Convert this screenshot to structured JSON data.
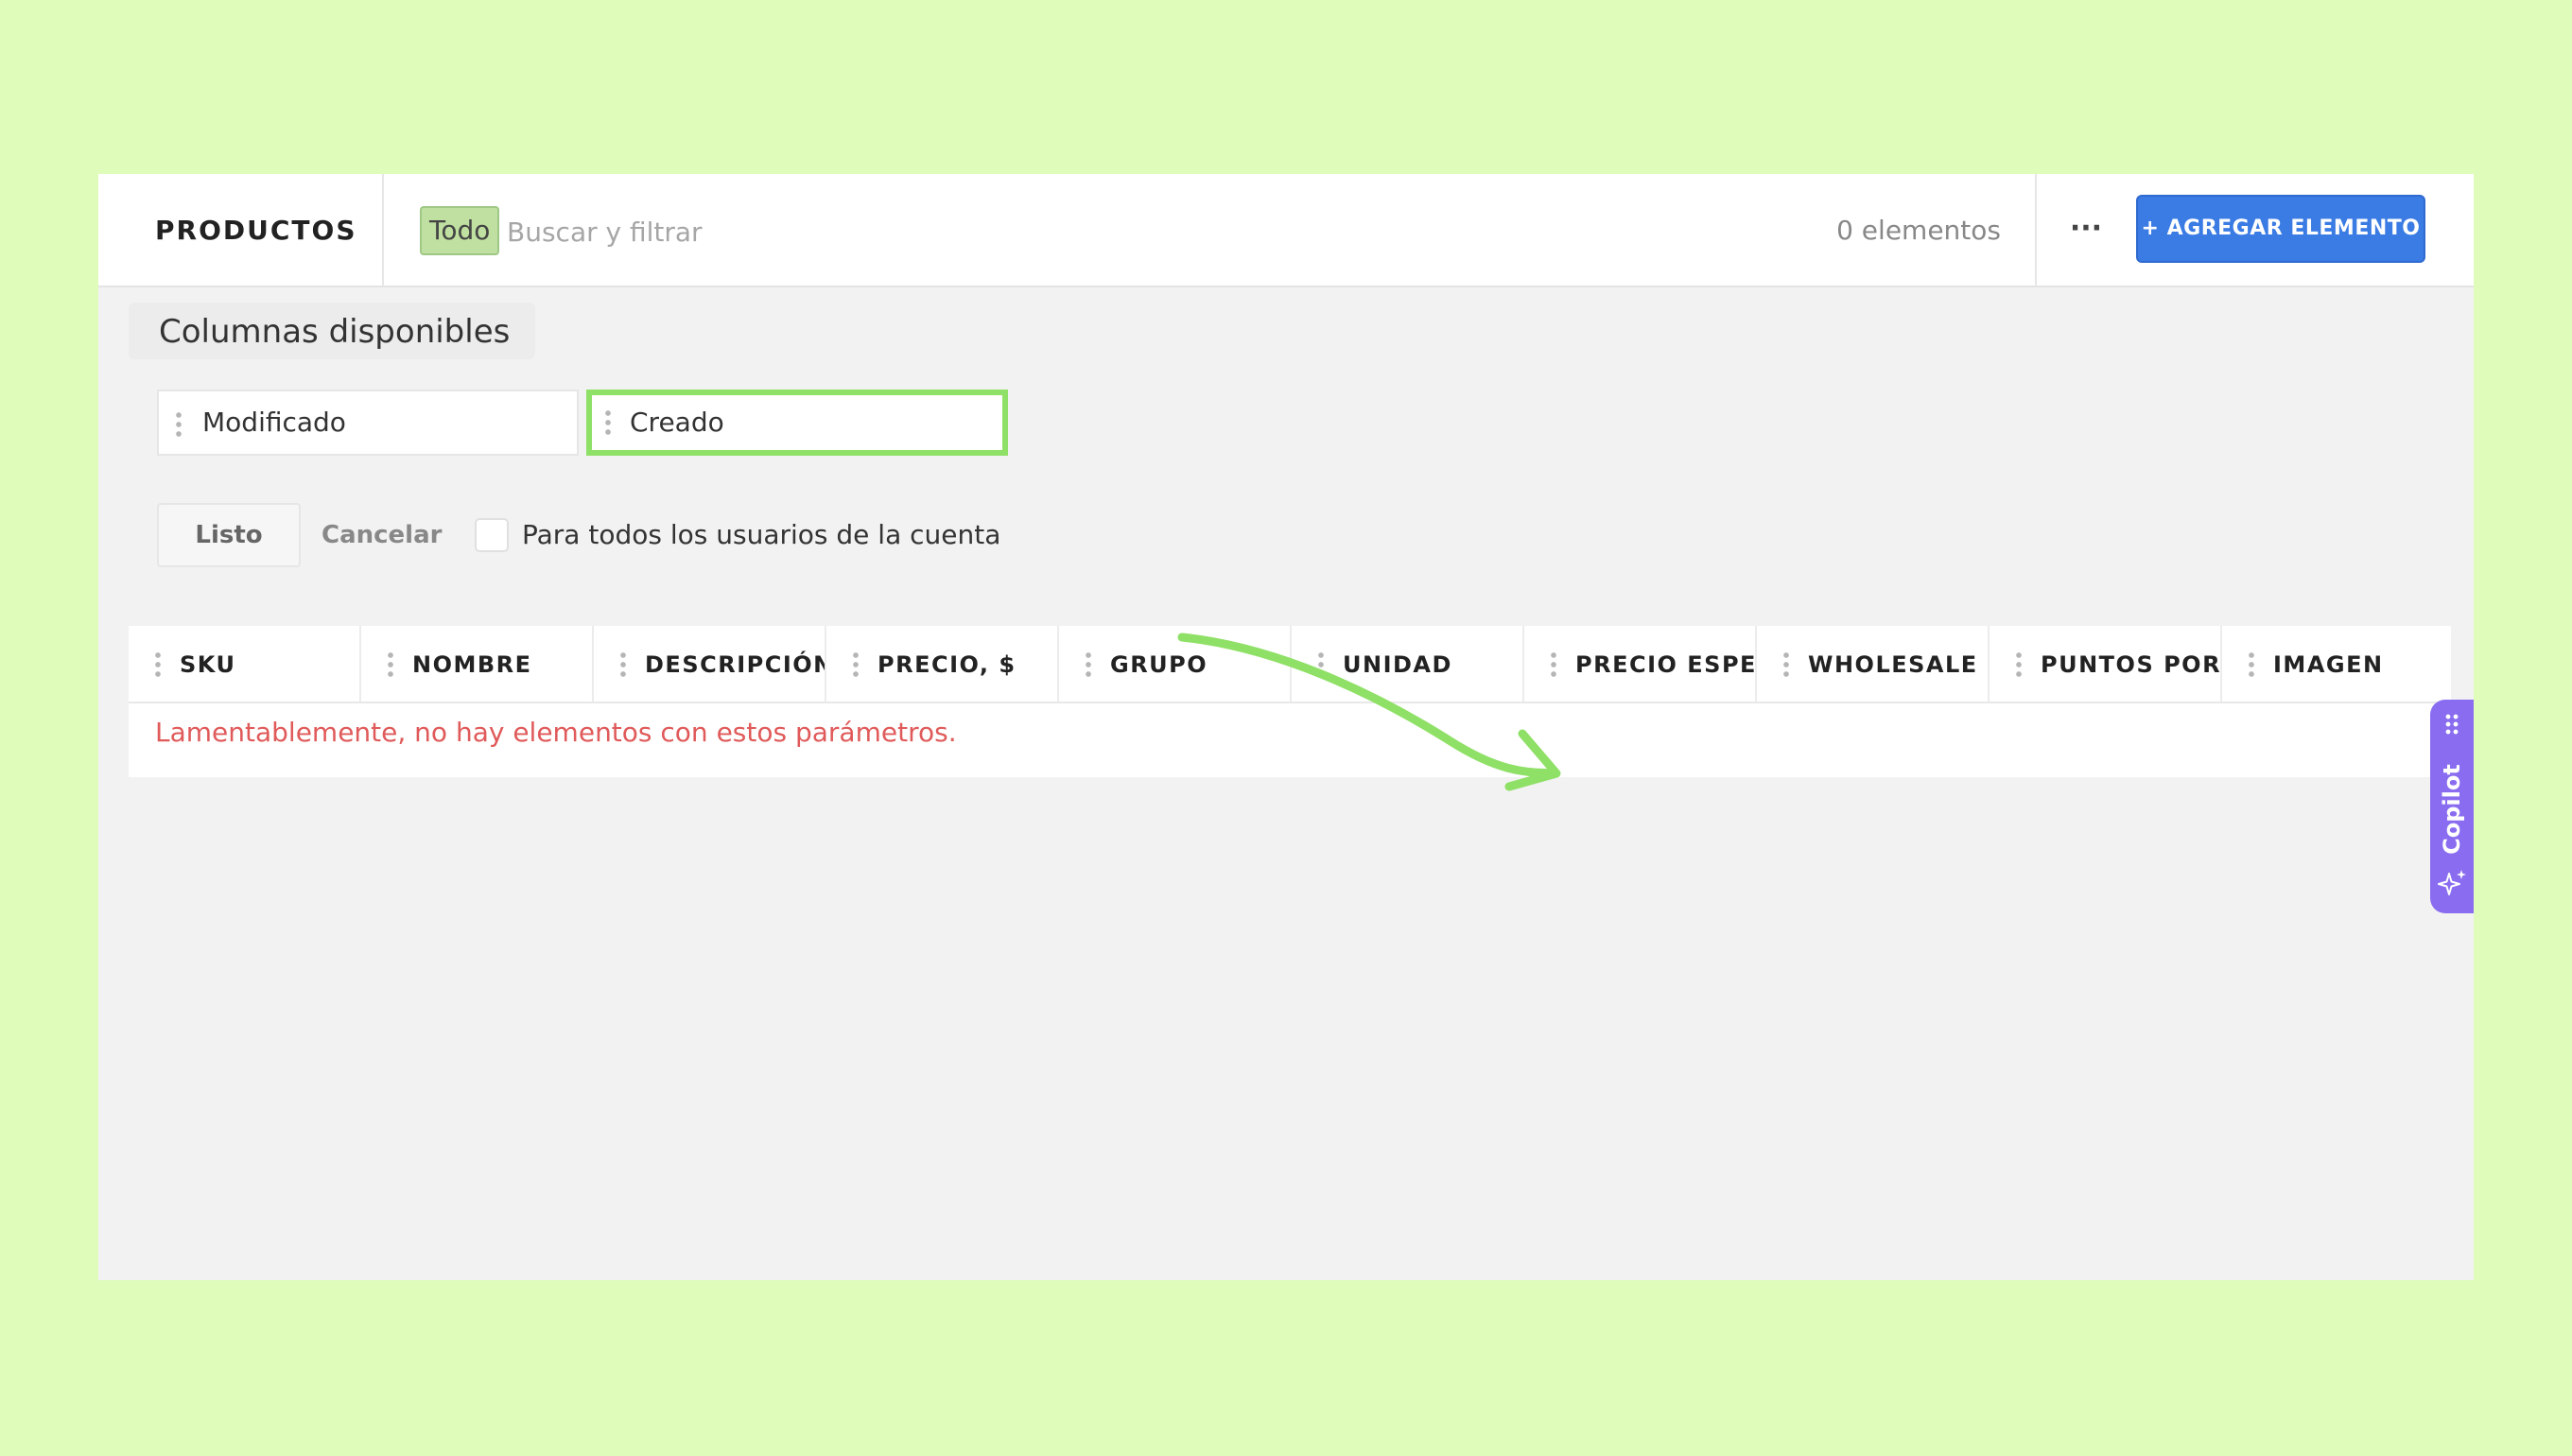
{
  "header": {
    "title": "PRODUCTOS",
    "filter_tag": "Todo",
    "search_placeholder": "Buscar y filtrar",
    "count": "0 elementos",
    "more_label": "···",
    "add_button": "+ AGREGAR ELEMENTO"
  },
  "available_columns": {
    "title": "Columnas disponibles",
    "items": [
      "Modificado",
      "Creado"
    ]
  },
  "actions": {
    "done": "Listo",
    "cancel": "Cancelar",
    "all_users_label": "Para todos los usuarios de la cuenta"
  },
  "table": {
    "columns": [
      "SKU",
      "NOMBRE",
      "DESCRIPCIÓN",
      "PRECIO, $",
      "GRUPO",
      "UNIDAD",
      "PRECIO ESPECIAL",
      "WHOLESALE PRICE",
      "PUNTOS POR COMPRA",
      "IMAGEN"
    ],
    "empty_message": "Lamentablemente, no hay elementos con estos parámetros."
  },
  "copilot": {
    "label": "Copilot"
  },
  "colors": {
    "background": "#e0fcbb",
    "accent_blue": "#3a7be4",
    "highlight_green": "#8fe066",
    "error_red": "#e05a5a",
    "copilot_purple": "#8a6cf0"
  }
}
